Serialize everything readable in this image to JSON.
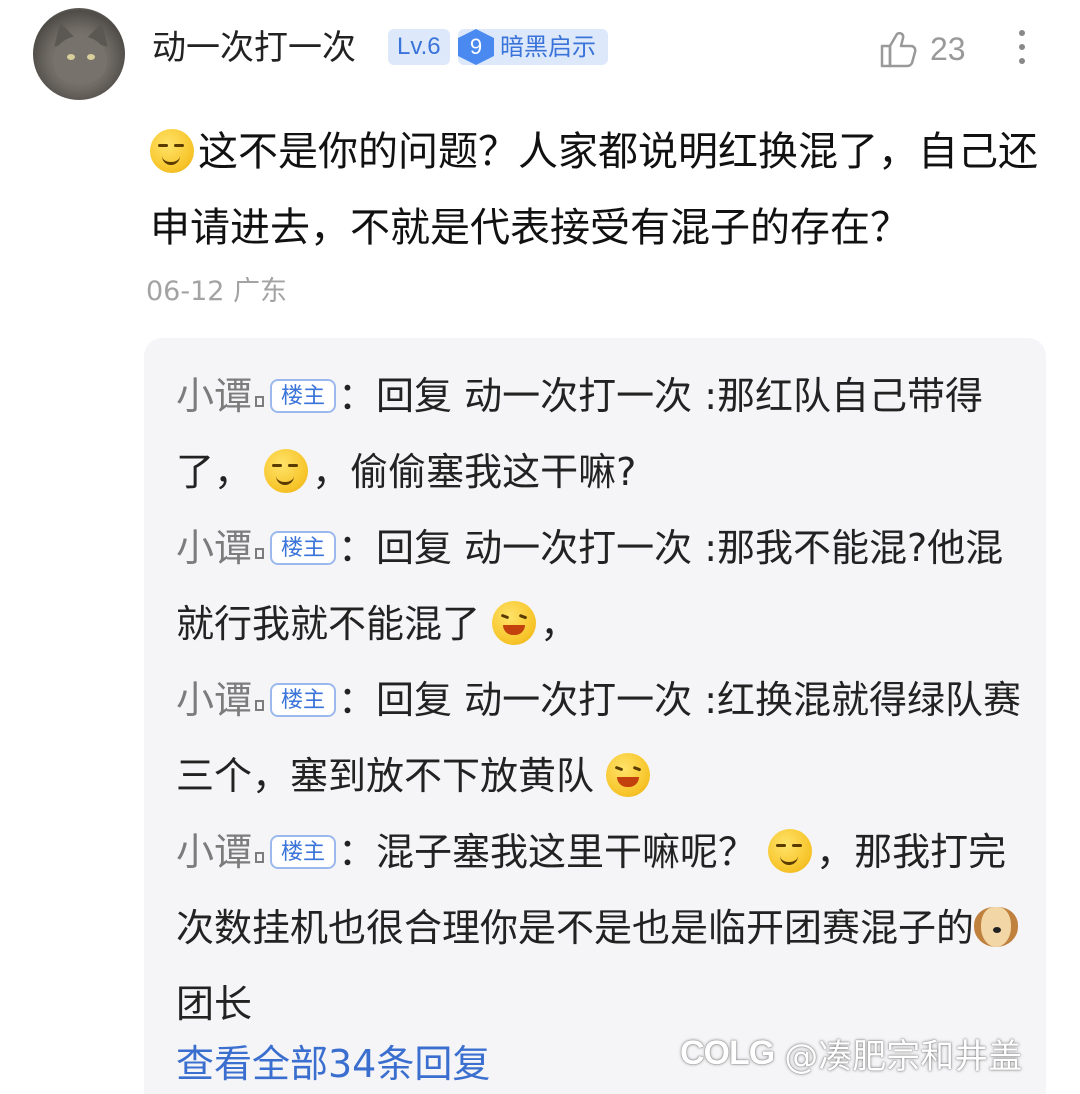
{
  "comment": {
    "author": "动一次打一次",
    "level": "Lv.6",
    "rank_number": "9",
    "rank_title": "暗黑启示",
    "likes": "23",
    "text": "这不是你的问题？人家都说明红换混了，自己还申请进去，不就是代表接受有混子的存在？",
    "date": "06-12",
    "location": "广东",
    "emoji_icon": "smirk-emoji-icon"
  },
  "replies": [
    {
      "author": "小谭",
      "tag": "楼主",
      "colon": "：",
      "before_emoji": "回复 动一次打一次 :那红队自己带得了，",
      "after_emoji": "，偷偷塞我这干嘛?",
      "emoji": "smirk-emoji-icon"
    },
    {
      "author": "小谭",
      "tag": "楼主",
      "colon": "：",
      "before_emoji": "回复 动一次打一次 :那我不能混?他混就行我就不能混了",
      "after_emoji": "，",
      "emoji": "laugh-emoji-icon"
    },
    {
      "author": "小谭",
      "tag": "楼主",
      "colon": "：",
      "before_emoji": "回复 动一次打一次 :红换混就得绿队赛三个，塞到放不下放黄队",
      "after_emoji": "",
      "emoji": "laugh-emoji-icon"
    },
    {
      "author": "小谭",
      "tag": "楼主",
      "colon": "：",
      "before_emoji": "混子塞我这里干嘛呢？",
      "middle": "，那我打完次数挂机也很合理你是不是也是临开团赛混子的",
      "after_emoji": "团长",
      "emoji": "smirk-emoji-icon",
      "emoji2": "dog-emoji-icon"
    }
  ],
  "view_all": "查看全部34条回复",
  "watermark": {
    "logo": "COLG",
    "text": "@凑肥宗和井盖"
  },
  "colors": {
    "link": "#3b6fcf",
    "badge_bg": "#dde9fb",
    "badge_text": "#3a73d9",
    "reply_bg": "#f5f5f7"
  }
}
